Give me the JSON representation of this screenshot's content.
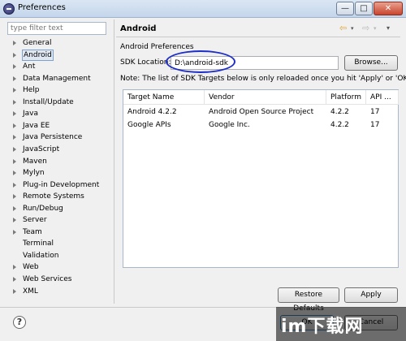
{
  "window": {
    "title": "Preferences",
    "min_glyph": "—",
    "max_glyph": "□",
    "close_glyph": "✕"
  },
  "filter": {
    "placeholder": "type filter text"
  },
  "tree": {
    "items": [
      {
        "label": "General",
        "expandable": true
      },
      {
        "label": "Android",
        "expandable": true,
        "selected": true
      },
      {
        "label": "Ant",
        "expandable": true
      },
      {
        "label": "Data Management",
        "expandable": true
      },
      {
        "label": "Help",
        "expandable": true
      },
      {
        "label": "Install/Update",
        "expandable": true
      },
      {
        "label": "Java",
        "expandable": true
      },
      {
        "label": "Java EE",
        "expandable": true
      },
      {
        "label": "Java Persistence",
        "expandable": true
      },
      {
        "label": "JavaScript",
        "expandable": true
      },
      {
        "label": "Maven",
        "expandable": true
      },
      {
        "label": "Mylyn",
        "expandable": true
      },
      {
        "label": "Plug-in Development",
        "expandable": true
      },
      {
        "label": "Remote Systems",
        "expandable": true
      },
      {
        "label": "Run/Debug",
        "expandable": true
      },
      {
        "label": "Server",
        "expandable": true
      },
      {
        "label": "Team",
        "expandable": true
      },
      {
        "label": "Terminal",
        "expandable": false
      },
      {
        "label": "Validation",
        "expandable": false
      },
      {
        "label": "Web",
        "expandable": true
      },
      {
        "label": "Web Services",
        "expandable": true
      },
      {
        "label": "XML",
        "expandable": true
      }
    ]
  },
  "page": {
    "title": "Android",
    "heading": "Android Preferences",
    "nav": {
      "back": "⇦",
      "back_dd": "▾",
      "forward": "⇨",
      "forward_dd": "▾",
      "menu": "▾"
    }
  },
  "sdk": {
    "label": "SDK Location:",
    "value": "D:\\android-sdk",
    "browse_label": "Browse...",
    "note": "Note: The list of SDK Targets below is only reloaded once you hit 'Apply' or 'OK'."
  },
  "targets_table": {
    "columns": [
      "Target Name",
      "Vendor",
      "Platform",
      "API ..."
    ],
    "rows": [
      [
        "Android 4.2.2",
        "Android Open Source Project",
        "4.2.2",
        "17"
      ],
      [
        "Google APIs",
        "Google Inc.",
        "4.2.2",
        "17"
      ]
    ]
  },
  "buttons": {
    "restore_defaults": "Restore Defaults",
    "apply": "Apply",
    "ok": "OK",
    "cancel": "Cancel",
    "help": "?"
  },
  "watermark": {
    "text": "im下载网"
  }
}
